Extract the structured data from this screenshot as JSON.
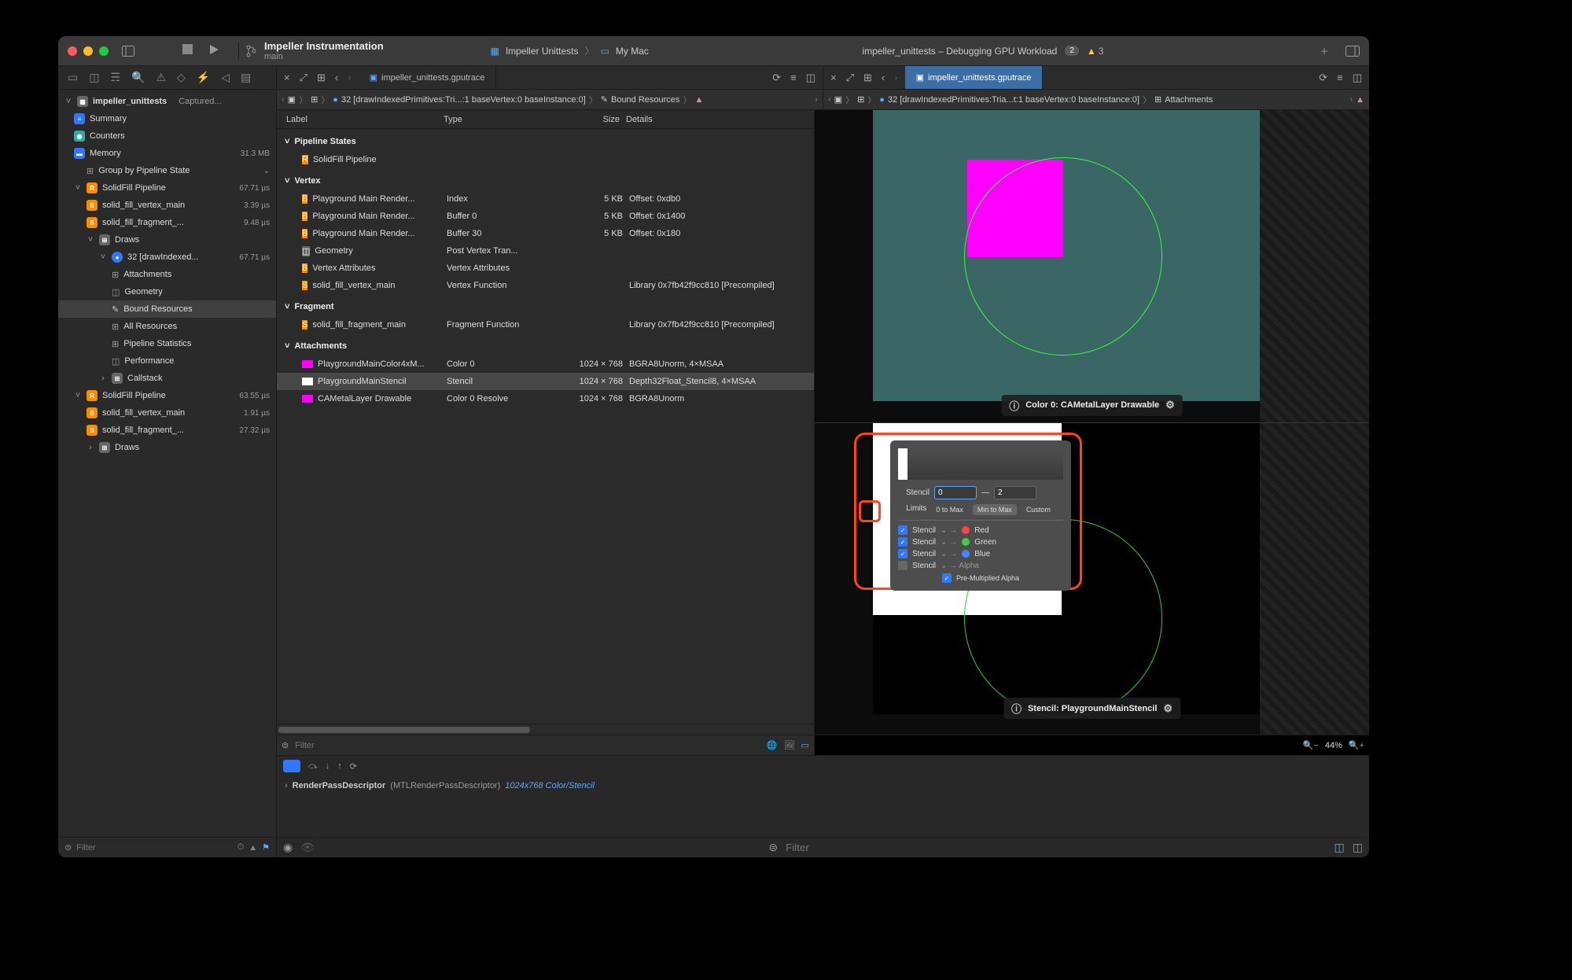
{
  "titlebar": {
    "project_name": "Impeller Instrumentation",
    "branch": "main",
    "scheme": "Impeller Unittests",
    "target": "My Mac",
    "status_text": "impeller_unittests – Debugging GPU Workload",
    "status_badge": "2",
    "warn_count": "3"
  },
  "navigator": {
    "root": "impeller_unittests",
    "root_suffix": "Captured...",
    "summary": "Summary",
    "counters": "Counters",
    "memory": "Memory",
    "memory_size": "31.3 MB",
    "group_by": "Group by Pipeline State",
    "pipeline1": "SolidFill Pipeline",
    "pipeline1_time": "67.71 µs",
    "p1_vertex": "solid_fill_vertex_main",
    "p1_vertex_time": "3.39 µs",
    "p1_frag": "solid_fill_fragment_...",
    "p1_frag_time": "9.48 µs",
    "draws": "Draws",
    "draw32": "32 [drawIndexed...",
    "draw32_time": "67.71 µs",
    "attachments": "Attachments",
    "geometry": "Geometry",
    "bound_resources": "Bound Resources",
    "all_resources": "All Resources",
    "pipeline_stats": "Pipeline Statistics",
    "performance": "Performance",
    "callstack": "Callstack",
    "pipeline2": "SolidFill Pipeline",
    "pipeline2_time": "63.55 µs",
    "p2_vertex": "solid_fill_vertex_main",
    "p2_vertex_time": "1.91 µs",
    "p2_frag": "solid_fill_fragment_...",
    "p2_frag_time": "27.32 µs",
    "p2_draws": "Draws",
    "filter_placeholder": "Filter"
  },
  "tabs": {
    "left_tab": "impeller_unittests.gputrace",
    "right_tab": "impeller_unittests.gputrace"
  },
  "pathbar": {
    "left_draw": "32 [drawIndexedPrimitives:Tri...:1 baseVertex:0 baseInstance:0]",
    "left_end": "Bound Resources",
    "right_draw": "32 [drawIndexedPrimitives:Tria...t:1 baseVertex:0 baseInstance:0]",
    "right_end": "Attachments"
  },
  "table": {
    "headers": {
      "label": "Label",
      "type": "Type",
      "size": "Size",
      "details": "Details"
    },
    "groups": {
      "pipeline_states": "Pipeline States",
      "vertex": "Vertex",
      "fragment": "Fragment",
      "attachments": "Attachments"
    },
    "rows": {
      "solidfill": {
        "label": "SolidFill Pipeline"
      },
      "v0": {
        "label": "Playground Main Render...",
        "type": "Index",
        "size": "5 KB",
        "details": "Offset: 0xdb0"
      },
      "v1": {
        "label": "Playground Main Render...",
        "type": "Buffer 0",
        "size": "5 KB",
        "details": "Offset: 0x1400"
      },
      "v2": {
        "label": "Playground Main Render...",
        "type": "Buffer 30",
        "size": "5 KB",
        "details": "Offset: 0x180"
      },
      "v3": {
        "label": "Geometry",
        "type": "Post Vertex Tran..."
      },
      "v4": {
        "label": "Vertex Attributes",
        "type": "Vertex Attributes"
      },
      "v5": {
        "label": "solid_fill_vertex_main",
        "type": "Vertex Function",
        "details": "Library 0x7fb42f9cc810 [Precompiled]"
      },
      "f0": {
        "label": "solid_fill_fragment_main",
        "type": "Fragment Function",
        "details": "Library 0x7fb42f9cc810 [Precompiled]"
      },
      "a0": {
        "label": "PlaygroundMainColor4xM...",
        "type": "Color 0",
        "size": "1024 × 768",
        "details": "BGRA8Unorm, 4×MSAA"
      },
      "a1": {
        "label": "PlaygroundMainStencil",
        "type": "Stencil",
        "size": "1024 × 768",
        "details": "Depth32Float_Stencil8, 4×MSAA"
      },
      "a2": {
        "label": "CAMetalLayer Drawable",
        "type": "Color 0 Resolve",
        "size": "1024 × 768",
        "details": "BGRA8Unorm"
      }
    }
  },
  "filter_left": {
    "placeholder": "Filter"
  },
  "debug": {
    "rpd": "RenderPassDescriptor",
    "rpd_type": "(MTLRenderPassDescriptor)",
    "rpd_info": "1024x768 Color/Stencil"
  },
  "render": {
    "top_label": "Color 0: CAMetalLayer Drawable",
    "bot_label": "Stencil: PlaygroundMainStencil",
    "zoom": "44%"
  },
  "popover": {
    "stencil_label": "Stencil",
    "min": "0",
    "max": "2",
    "dash": "—",
    "limits": "Limits",
    "btn_0max": "0 to Max",
    "btn_minmax": "Min to Max",
    "btn_custom": "Custom",
    "ch_stencil": "Stencil",
    "red": "Red",
    "green": "Green",
    "blue": "Blue",
    "alpha_label": "Pre-Multiplied Alpha"
  },
  "right_filter": {
    "placeholder": "Filter"
  }
}
